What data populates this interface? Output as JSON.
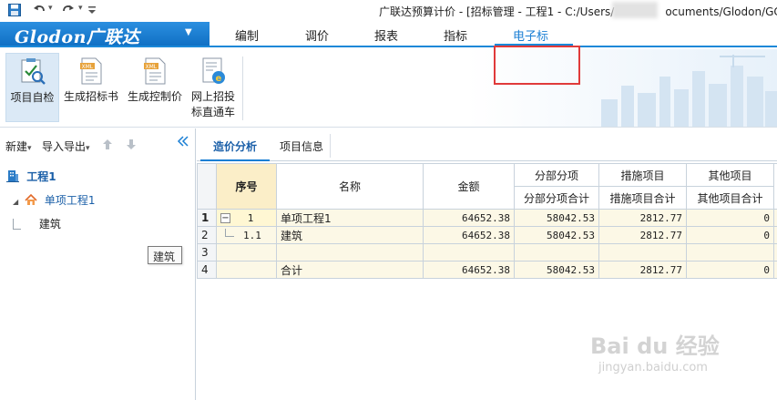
{
  "window": {
    "title": "广联达预算计价 - [招标管理 - 工程1 - C:/Users/",
    "title_tail": "ocuments/Glodon/GC"
  },
  "quick_access": {
    "save_icon": "save-icon",
    "undo_icon": "undo-icon",
    "redo_icon": "redo-icon",
    "customize_icon": "customize-icon"
  },
  "logo": {
    "text": "Glodon广联达",
    "caret": "▼"
  },
  "ribbon_tabs": [
    {
      "label": "编制",
      "active": false
    },
    {
      "label": "调价",
      "active": false
    },
    {
      "label": "报表",
      "active": false
    },
    {
      "label": "指标",
      "active": false
    },
    {
      "label": "电子标",
      "active": true
    }
  ],
  "ribbon_buttons": [
    {
      "label": "项目自检",
      "icon": "check-inspect-icon",
      "selected": true
    },
    {
      "label": "生成招标书",
      "icon": "xml-tender-icon",
      "selected": false
    },
    {
      "label": "生成控制价",
      "icon": "xml-control-price-icon",
      "selected": false
    },
    {
      "label": "网上招投",
      "label2": "标直通车",
      "icon": "online-bidding-icon",
      "selected": false
    }
  ],
  "left_toolbar": {
    "new_label": "新建",
    "import_export_label": "导入导出",
    "move_up_icon": "arrow-up-icon",
    "move_down_icon": "arrow-down-icon",
    "collapse_icon": "double-chevron-left-icon",
    "caret": "▾"
  },
  "tree": {
    "project": "工程1",
    "unit_project": "单项工程1",
    "discipline": "建筑",
    "expander": "◢"
  },
  "tooltip": "建筑",
  "main_tabs": [
    {
      "label": "造价分析",
      "active": true
    },
    {
      "label": "项目信息",
      "active": false
    }
  ],
  "grid": {
    "headers": {
      "seq": "序号",
      "name": "名称",
      "amount": "金额",
      "fenbu": "分部分项",
      "fenbu_total": "分部分项合计",
      "cuoshi": "措施项目",
      "cuoshi_total": "措施项目合计",
      "qita": "其他项目",
      "qita_total": "其他项目合计"
    },
    "rows": [
      {
        "rn": "1",
        "seq": "1",
        "name": "单项工程1",
        "amount": "64652.38",
        "fenbu": "58042.53",
        "cuoshi": "2812.77",
        "qita": "0",
        "expander": "−"
      },
      {
        "rn": "2",
        "seq": "1.1",
        "name": "建筑",
        "amount": "64652.38",
        "fenbu": "58042.53",
        "cuoshi": "2812.77",
        "qita": "0"
      },
      {
        "rn": "3",
        "seq": "",
        "name": "",
        "amount": "",
        "fenbu": "",
        "cuoshi": "",
        "qita": ""
      },
      {
        "rn": "4",
        "seq": "",
        "name": "合计",
        "amount": "64652.38",
        "fenbu": "58042.53",
        "cuoshi": "2812.77",
        "qita": "0"
      }
    ]
  },
  "watermark": {
    "brand": "Bai du 经验",
    "url": "jingyan.baidu.com"
  },
  "colors": {
    "accent": "#1a88d8",
    "highlight": "#e03a3a",
    "seq_header": "#fbeec8",
    "row_bg": "#fcf8e6"
  }
}
